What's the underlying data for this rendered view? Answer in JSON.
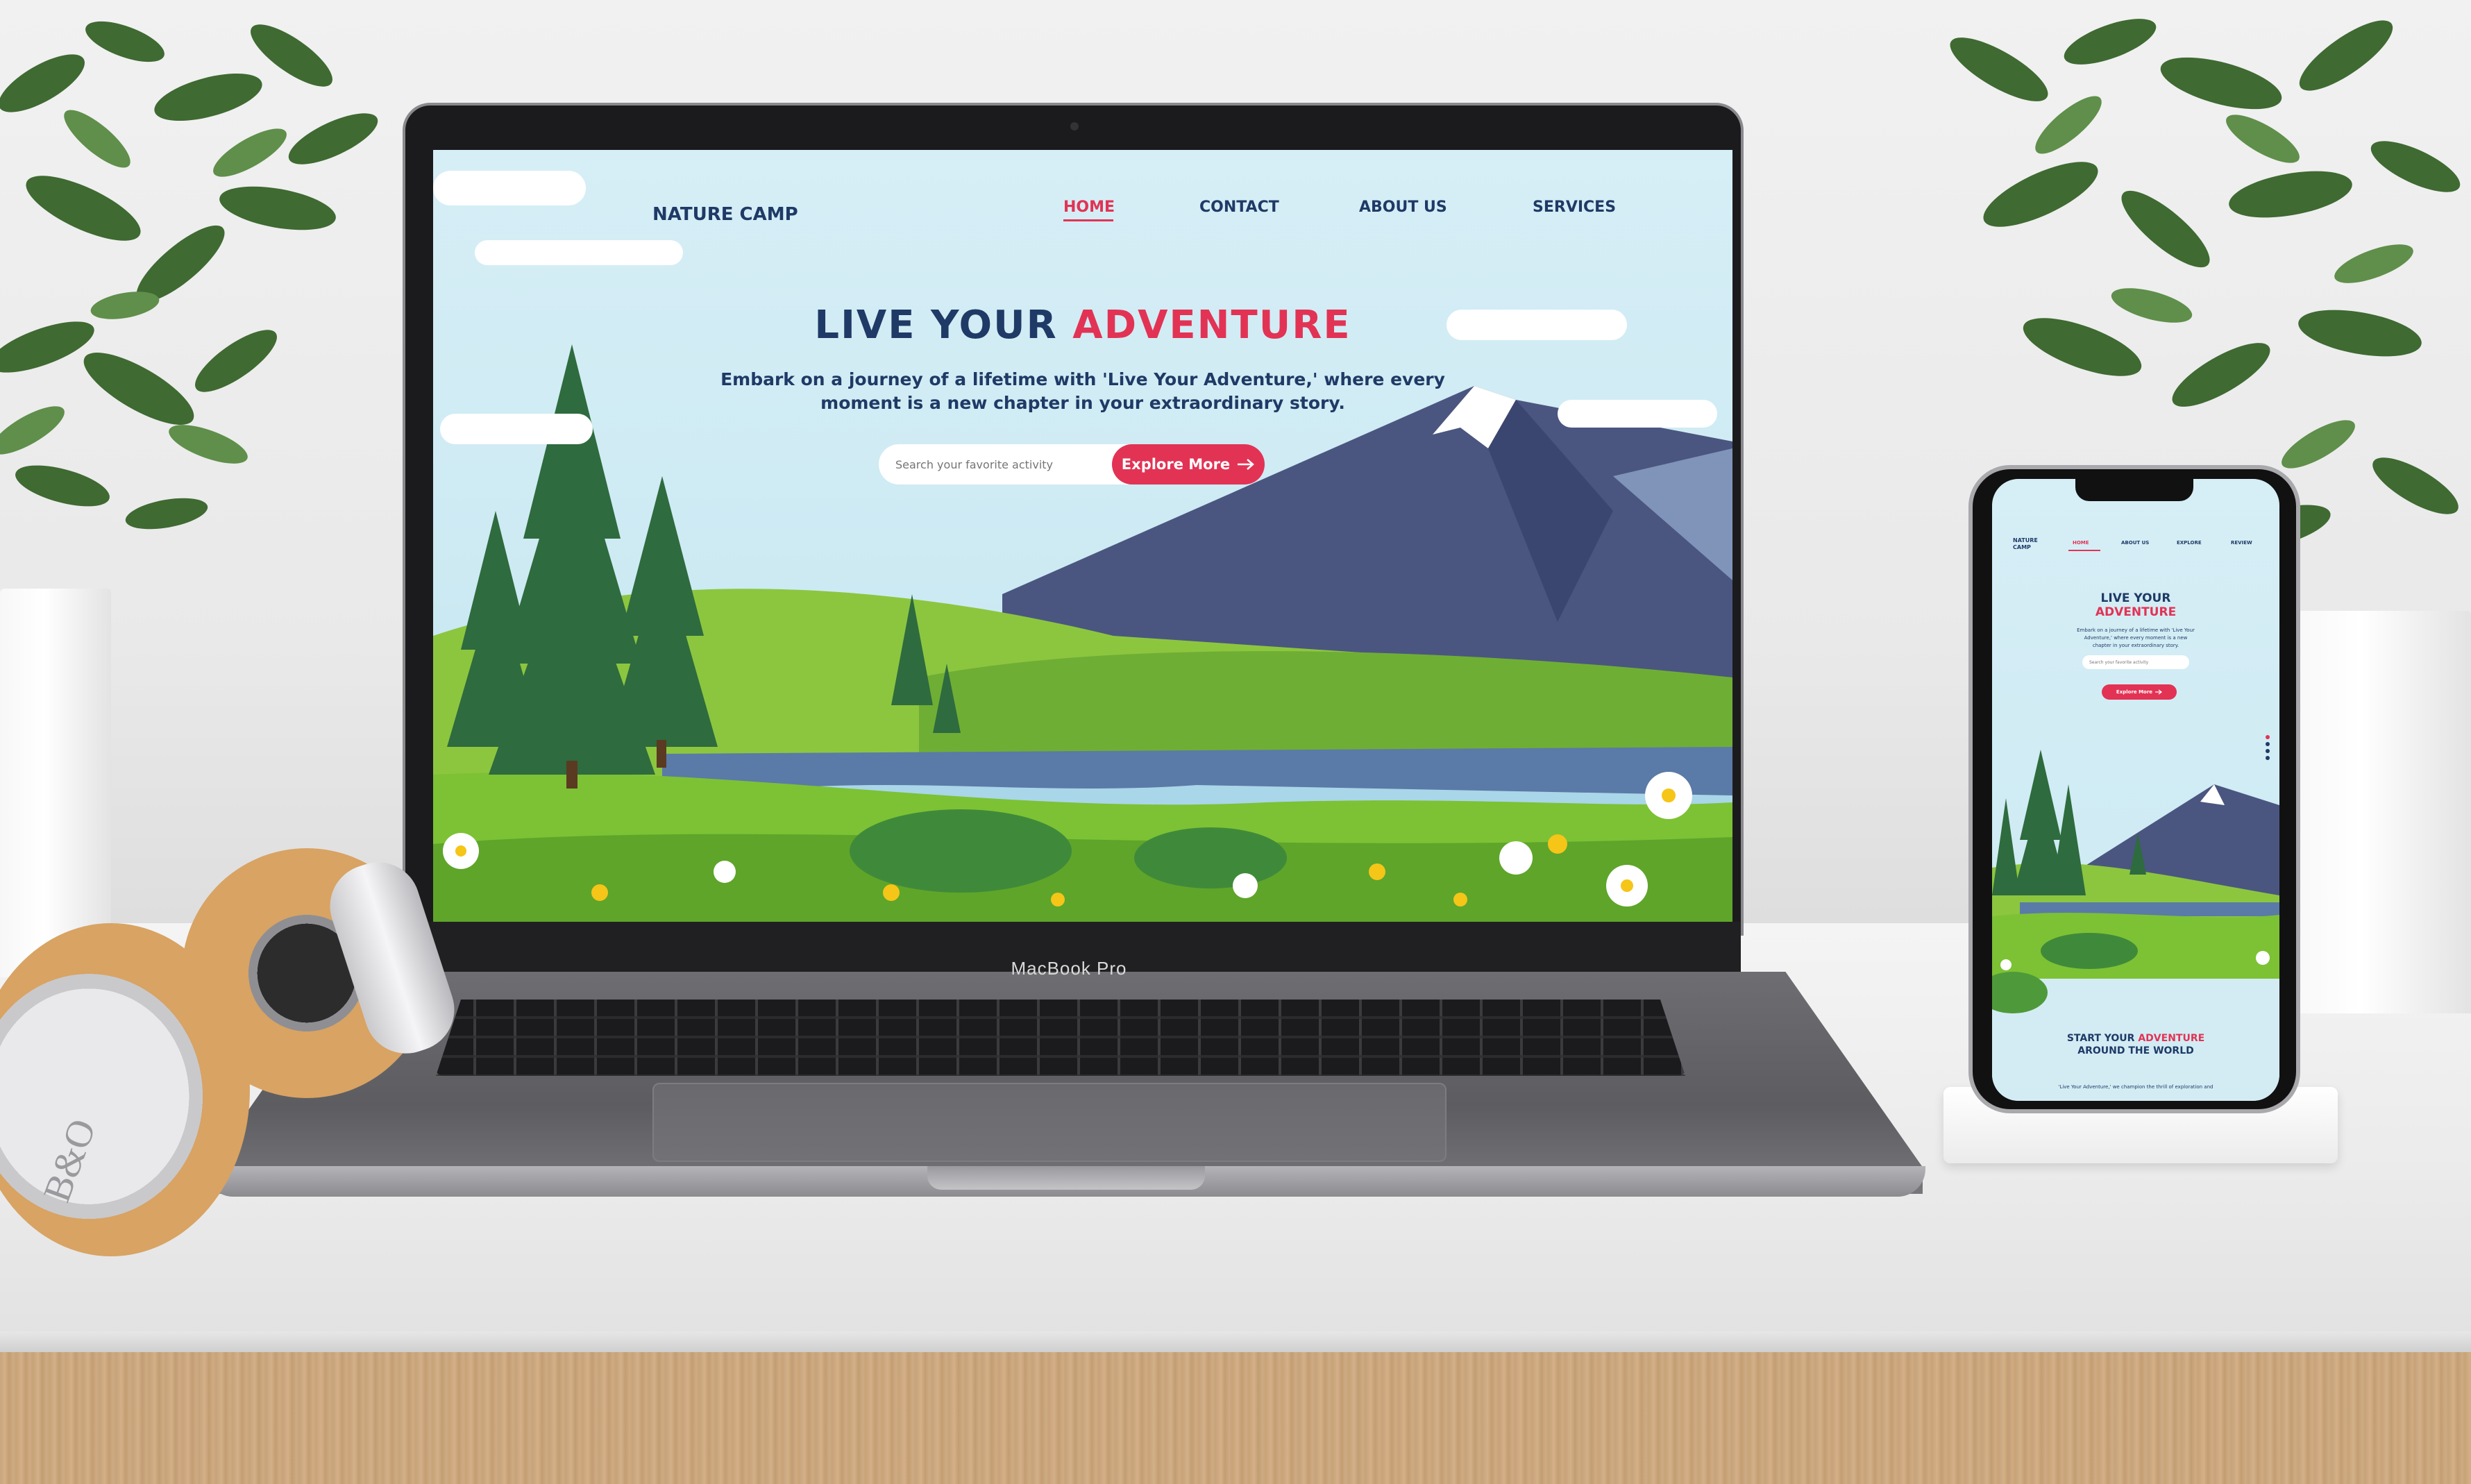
{
  "laptop": {
    "brand": "MacBook Pro",
    "site": {
      "logo": "NATURE CAMP",
      "nav": [
        "HOME",
        "CONTACT",
        "ABOUT US",
        "SERVICES"
      ],
      "active_nav": "HOME",
      "hero": {
        "title_part1": "LIVE YOUR",
        "title_part2": "ADVENTURE",
        "subtitle_line1": "Embark on a journey of a lifetime with 'Live Your Adventure,' where every",
        "subtitle_line2": "moment is a new chapter in your extraordinary story.",
        "search_placeholder": "Search your favorite activity",
        "cta_label": "Explore More"
      }
    }
  },
  "phone": {
    "site": {
      "logo_line1": "NATURE",
      "logo_line2": "CAMP",
      "nav": [
        "HOME",
        "ABOUT US",
        "EXPLORE",
        "REVIEW"
      ],
      "active_nav": "HOME",
      "hero": {
        "title_part1": "LIVE YOUR",
        "title_part2": "ADVENTURE",
        "subtitle_line1": "Embark on a journey of a lifetime with 'Live Your",
        "subtitle_line2": "Adventure,' where every moment is a new",
        "subtitle_line3": "chapter in your extraordinary story.",
        "search_placeholder": "Search your favorite activity",
        "cta_label": "Explore More"
      },
      "section2": {
        "title_part1": "START YOUR",
        "title_part2": "ADVENTURE",
        "title_line2": "AROUND THE WORLD",
        "body": "'Live Your Adventure,' we champion the thrill of exploration and"
      }
    }
  },
  "headphones": {
    "brand_mark": "B&O"
  },
  "colors": {
    "navy": "#1f3a66",
    "accent": "#e23355",
    "sky": "#d6eef6",
    "grass": "#8cc63f",
    "mountain": "#4a5680"
  },
  "icons": [
    "arrow-right-icon"
  ]
}
